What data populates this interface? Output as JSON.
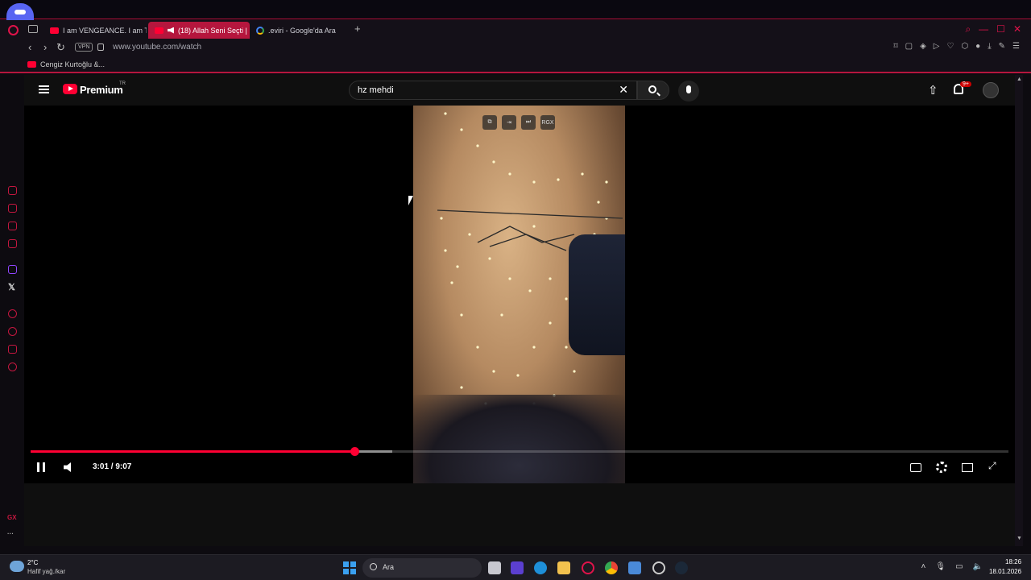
{
  "tabs": [
    {
      "label": "I am VENGEANCE. I am TH",
      "active": false
    },
    {
      "label": "(18) Allah Seni Seçti | I",
      "active": true
    },
    {
      "label": ".eviri - Google'da Ara",
      "active": false
    }
  ],
  "address": {
    "vpn_label": "VPN",
    "url": "www.youtube.com/watch"
  },
  "bookmarks": [
    {
      "label": "Cengiz Kurtoğlu &..."
    }
  ],
  "youtube": {
    "brand": "Premium",
    "region": "TR",
    "search_value": "hz mehdi",
    "notification_count": "9+",
    "overlay_buttons": [
      "⧉",
      "⇥",
      "⏭",
      "RGX"
    ]
  },
  "player": {
    "time_display": "3:01 / 9:07",
    "current_seconds": 181,
    "duration_seconds": 547,
    "buffered_fraction": 0.37
  },
  "taskbar": {
    "weather_temp": "2°C",
    "weather_desc": "Hafif yağ./kar",
    "search_label": "Ara",
    "clock_time": "18:26",
    "clock_date": "18.01.2026"
  },
  "colors": {
    "accent": "#b5163d",
    "youtube_red": "#ff0033"
  }
}
